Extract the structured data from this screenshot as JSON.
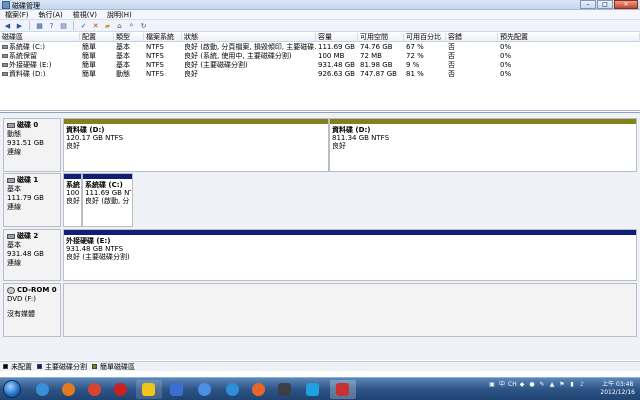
{
  "window": {
    "title": "磁碟管理"
  },
  "menu": [
    {
      "label": "檔案(F)"
    },
    {
      "label": "執行(A)"
    },
    {
      "label": "檢視(V)"
    },
    {
      "label": "說明(H)"
    }
  ],
  "toolbar": {
    "icons": [
      "back-icon",
      "forward-icon",
      "grid-icon",
      "help-icon",
      "properties-icon",
      "settings-icon",
      "check-icon",
      "delete-icon",
      "folder-icon",
      "open-icon",
      "search-icon",
      "refresh-icon"
    ]
  },
  "volumes": {
    "headers": [
      "磁碟區",
      "配置",
      "類型",
      "檔案系統",
      "狀態",
      "容量",
      "可用空間",
      "可用百分比",
      "容錯",
      "預先配置"
    ],
    "rows": [
      [
        "系統碟 (C:)",
        "簡單",
        "基本",
        "NTFS",
        "良好 (啟動, 分頁檔案, 損毀傾印, 主要磁碟...",
        "111.69 GB",
        "74.76 GB",
        "67 %",
        "否",
        "0%"
      ],
      [
        "系統保留",
        "簡單",
        "基本",
        "NTFS",
        "良好 (系統, 使用中, 主要磁碟分割)",
        "100 MB",
        "72 MB",
        "72 %",
        "否",
        "0%"
      ],
      [
        "外接硬碟 (E:)",
        "簡單",
        "基本",
        "NTFS",
        "良好 (主要磁碟分割)",
        "931.48 GB",
        "81.98 GB",
        "9 %",
        "否",
        "0%"
      ],
      [
        "資料碟 (D:)",
        "簡單",
        "動態",
        "NTFS",
        "良好",
        "926.63 GB",
        "747.87 GB",
        "81 %",
        "否",
        "0%"
      ]
    ]
  },
  "disks": [
    {
      "name": "磁碟 0",
      "type": "動態",
      "size": "931.51 GB",
      "status": "連線",
      "partitions": [
        {
          "name": "資料碟 (D:)",
          "size": "120.17 GB NTFS",
          "status": "良好",
          "stripe": "#84811a"
        },
        {
          "name": "資料碟 (D:)",
          "size": "811.34 GB NTFS",
          "status": "良好",
          "stripe": "#84811a"
        }
      ]
    },
    {
      "name": "磁碟 1",
      "type": "基本",
      "size": "111.79 GB",
      "status": "連線",
      "partitions": [
        {
          "name": "系統",
          "size": "100",
          "status": "良好",
          "stripe": "#0f1f78"
        },
        {
          "name": "系統碟 (C:)",
          "size": "111.69 GB NT",
          "status": "良好 (啟動, 分",
          "stripe": "#0f1f78"
        }
      ]
    },
    {
      "name": "磁碟 2",
      "type": "基本",
      "size": "931.48 GB",
      "status": "連線",
      "partitions": [
        {
          "name": "外接硬碟 (E:)",
          "size": "931.48 GB NTFS",
          "status": "良好 (主要磁碟分割)",
          "stripe": "#0f1f78"
        }
      ]
    },
    {
      "name": "CD-ROM 0",
      "type": "DVD (F:)",
      "size": "",
      "status": "沒有媒體",
      "partitions": []
    }
  ],
  "legend": [
    {
      "label": "未配置",
      "color": "#000000"
    },
    {
      "label": "主要磁碟分割",
      "color": "#0f1f78"
    },
    {
      "label": "簡單磁碟區",
      "color": "#84811a"
    }
  ],
  "taskbar": {
    "apps": [
      {
        "name": "ie-icon",
        "color": "#3a8fd6"
      },
      {
        "name": "firefox-icon",
        "color": "#e57a1f"
      },
      {
        "name": "chrome-icon",
        "color": "#d9442f"
      },
      {
        "name": "opera-icon",
        "color": "#cc1f1f"
      },
      {
        "name": "tool-icon",
        "color": "#f0c419"
      },
      {
        "name": "media-icon",
        "color": "#3b6ed1"
      },
      {
        "name": "app-icon-blue",
        "color": "#4a90e2"
      },
      {
        "name": "globe-icon",
        "color": "#2c8ed6"
      },
      {
        "name": "orange-app-icon",
        "color": "#e8662a"
      },
      {
        "name": "dark-app-icon",
        "color": "#3a3f48"
      },
      {
        "name": "skype-icon",
        "color": "#1fa0e0"
      },
      {
        "name": "disk-mgmt-icon",
        "color": "#c93030"
      }
    ],
    "clock_time": "上午 03:48",
    "clock_date": "2012/12/16",
    "tray_ime": "中",
    "tray_ch": "CH"
  }
}
